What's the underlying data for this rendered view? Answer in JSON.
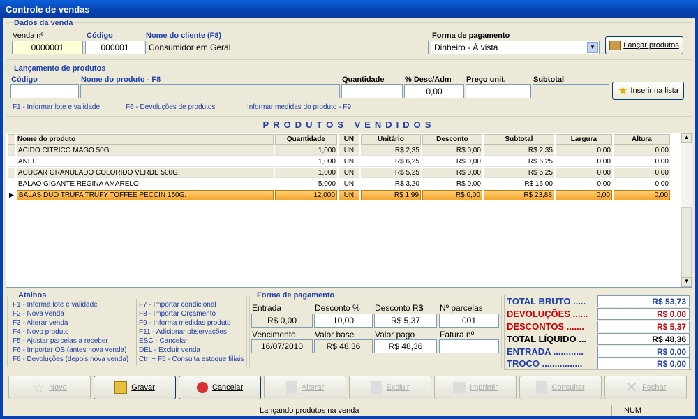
{
  "window": {
    "title": "Controle de vendas"
  },
  "dados": {
    "legend": "Dados da venda",
    "venda_label": "Venda nº",
    "venda_value": "0000001",
    "codigo_label": "Código",
    "codigo_value": "000001",
    "cliente_label": "Nome do cliente (F8)",
    "cliente_value": "Consumidor em Geral",
    "pagamento_label": "Forma de pagamento",
    "pagamento_value": "Dinheiro - À vista",
    "lancar_label": "Lançar produtos"
  },
  "lanc": {
    "legend": "Lançamento de produtos",
    "codigo_label": "Código",
    "nome_label": "Nome do produto - F8",
    "qtd_label": "Quantidade",
    "desc_label": "% Desc/Adm",
    "desc_value": "0,00",
    "preco_label": "Preço unit.",
    "subtotal_label": "Subtotal",
    "inserir_label": "Inserir na lista",
    "hint1": "F1 - Informar lote e validade",
    "hint2": "F6 - Devoluções de produtos",
    "hint3": "Informar medidas do produto - F9"
  },
  "grid": {
    "title": "PRODUTOS VENDIDOS",
    "columns": [
      "Nome do produto",
      "Quantidade",
      "UN",
      "Unitário",
      "Desconto",
      "Subtotal",
      "Largura",
      "Altura"
    ],
    "rows": [
      [
        "ACIDO CITRICO MAGO 50G.",
        "1,000",
        "UN",
        "R$ 2,35",
        "R$ 0,00",
        "R$ 2,35",
        "0,00",
        "0,00"
      ],
      [
        "ANEL",
        "1,000",
        "UN",
        "R$ 6,25",
        "R$ 0,00",
        "R$ 6,25",
        "0,00",
        "0,00"
      ],
      [
        "ACUCAR GRANULADO COLORIDO VERDE 500G.",
        "1,000",
        "UN",
        "R$ 5,25",
        "R$ 0,00",
        "R$ 5,25",
        "0,00",
        "0,00"
      ],
      [
        "BALAO GIGANTE REGINA AMARELO",
        "5,000",
        "UN",
        "R$ 3,20",
        "R$ 0,00",
        "R$ 16,00",
        "0,00",
        "0,00"
      ],
      [
        "BALAS DUO TRUFA TRUFY TOFFEE PECCIN 150G.",
        "12,000",
        "UN",
        "R$ 1,99",
        "R$ 0,00",
        "R$ 23,88",
        "0,00",
        "0,00"
      ]
    ]
  },
  "atalhos": {
    "legend": "Atalhos",
    "left": [
      "F1 - Informa lote e validade",
      "F2 - Nova venda",
      "F3 - Alterar venda",
      "F4 - Novo produto",
      "F5 - Ajustar parcelas a receber",
      "F6 - Importar OS (antes nova venda)",
      "F6 - Devoluções (depois nova venda)"
    ],
    "right": [
      "F7 - Importar condicional",
      "F8 - Importar Orçamento",
      "F9 - Informa medidas produto",
      "F11 - Adicionar observações",
      "ESC - Cancelar",
      "DEL - Excluir venda",
      "Ctrl + F5 - Consulta estoque filiais"
    ]
  },
  "forma": {
    "legend": "Forma de pagamento",
    "entrada_label": "Entrada",
    "entrada_value": "R$ 0,00",
    "descpct_label": "Desconto %",
    "descpct_value": "10,00",
    "descrs_label": "Desconto R$",
    "descrs_value": "R$ 5,37",
    "parcelas_label": "Nº parcelas",
    "parcelas_value": "001",
    "venc_label": "Vencimento",
    "venc_value": "16/07/2010",
    "vbase_label": "Valor base",
    "vbase_value": "R$ 48,36",
    "vpago_label": "Valor pago",
    "vpago_value": "R$ 48,36",
    "fatura_label": "Fatura nº",
    "fatura_value": ""
  },
  "totais": {
    "bruto_label": "TOTAL BRUTO .....",
    "bruto_value": "R$ 53,73",
    "devol_label": "DEVOLUÇÕES ......",
    "devol_value": "R$ 0,00",
    "desc_label": "DESCONTOS .......",
    "desc_value": "R$ 5,37",
    "liquido_label": "TOTAL LÍQUIDO ...",
    "liquido_value": "R$ 48,36",
    "entrada_label": "ENTRADA ............",
    "entrada_value": "R$ 0,00",
    "troco_label": "TROCO ................",
    "troco_value": "R$ 0,00"
  },
  "buttons": {
    "novo": "Novo",
    "gravar": "Gravar",
    "cancelar": "Cancelar",
    "alterar": "Alterar",
    "excluir": "Excluir",
    "imprimir": "Imprimir",
    "consultar": "Consultar",
    "fechar": "Fechar"
  },
  "status": {
    "message": "Lançando produtos na venda",
    "num": "NUM"
  },
  "colors": {
    "title_bar": "#0842b0",
    "accent_blue": "#1f3fa8",
    "red": "#cc0000",
    "selected_row": "#f5a52b"
  }
}
